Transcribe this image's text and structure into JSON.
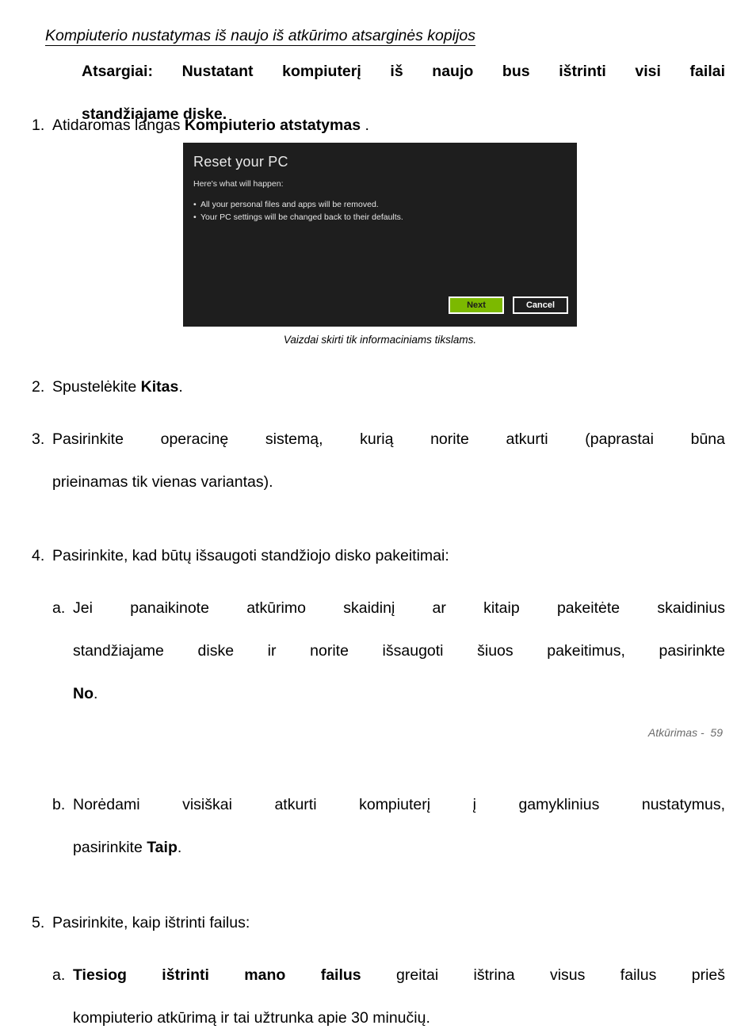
{
  "document": {
    "heading": "Kompiuterio nustatymas iš naujo iš atkūrimo atsarginės kopijos",
    "warning": {
      "line1": "Atsargiai: Nustatant kompiuterį iš naujo bus ištrinti visi failai",
      "line2": "standžiajame diske."
    },
    "steps": [
      {
        "marker": "1.",
        "text_before": "Atidaromas langas ",
        "bold": "Kompiuterio atstatymas",
        "text_after": " ."
      },
      {
        "marker": "2.",
        "text_before": "Spustelėkite ",
        "bold": "Kitas",
        "text_after": "."
      },
      {
        "marker": "3.",
        "line1": "Pasirinkite operacinę sistemą, kurią norite atkurti (paprastai būna",
        "line2": "prieinamas tik vienas variantas)."
      },
      {
        "marker": "4.",
        "text": "Pasirinkite, kad būtų išsaugoti standžiojo disko pakeitimai:"
      },
      {
        "marker": "a.",
        "line1": "Jei panaikinote atkūrimo skaidinį ar kitaip pakeitėte skaidinius",
        "line2": "standžiajame diske ir norite išsaugoti šiuos pakeitimus, pasirinkte",
        "line3_bold": "No",
        "line3_after": "."
      },
      {
        "marker": "b.",
        "line1": "Norėdami visiškai atkurti kompiuterį į gamyklinius nustatymus,",
        "line2_before": "pasirinkite ",
        "line2_bold": "Taip",
        "line2_after": "."
      },
      {
        "marker": "5.",
        "text": "Pasirinkite, kaip ištrinti failus:"
      },
      {
        "marker": "a.",
        "line1_bold": "Tiesiog ištrinti mano failus",
        "line1_after": " greitai ištrina visus failus prieš",
        "line2": "kompiuterio atkūrimą ir tai užtrunka apie 30 minučių."
      }
    ],
    "figure": {
      "title": "Reset your PC",
      "subtitle": "Here's what will happen:",
      "bullets": [
        "All your personal files and apps will be removed.",
        "Your PC settings will be changed back to their defaults."
      ],
      "bullet_glyph": "•",
      "buttons": {
        "next": "Next",
        "cancel": "Cancel"
      },
      "colors": {
        "background": "#1e1e1e",
        "next_button": "#7cb900",
        "text": "#e8e8e8"
      },
      "caption": "Vaizdai skirti tik informaciniams tikslams."
    },
    "footer": "Atkūrimas -  59"
  }
}
